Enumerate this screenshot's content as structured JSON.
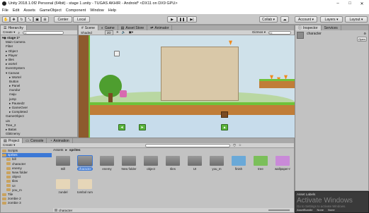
{
  "window": {
    "title": "Unity 2018.1.0f2 Personal (64bit) - stage 1.unity - TUGAS AKHIR - Android* <DX11 on DX9 GPU>",
    "minimize": "–",
    "maximize": "□",
    "close": "✕"
  },
  "menu": [
    "File",
    "Edit",
    "Assets",
    "GameObject",
    "Component",
    "Window",
    "Help"
  ],
  "toolbar": {
    "center": "Center",
    "local": "Local",
    "collab": "Collab ▾",
    "account": "Account ▾",
    "layers": "Layers ▾",
    "layout": "Layout ▾"
  },
  "hierarchy": {
    "tab": "Hierarchy",
    "create": "Create ▾",
    "search_placeholder": "All",
    "scene": "stage 1*",
    "items": [
      "Main Camera",
      "Fliter",
      "▸ Object",
      "▸ Player",
      "▸ tiles",
      "▸ wortel",
      "EventSystem",
      "▾ Canvas",
      "▸ Wortel",
      "Button",
      "▸ Panel",
      "mundur",
      "maju",
      "jump",
      "▸ Paused2",
      "▸ GameOver",
      "▸ Completed",
      "GameObject",
      "uis",
      "Tree_2",
      "▸ Batas",
      "GbEnemy"
    ]
  },
  "scene_view": {
    "tabs": [
      "Scene",
      "Game",
      "Asset Store",
      "Animator"
    ],
    "shaded": "Shaded",
    "mode_2d": "2D",
    "gizmos": "Gizmos ▾",
    "search_placeholder": "All"
  },
  "project": {
    "tabs": [
      "Project",
      "Console",
      "Animation"
    ],
    "create": "Create ▾",
    "tree": [
      "Scripts",
      "sprites",
      "bill",
      "character",
      "enemy",
      "New folder",
      "object",
      "tiles",
      "UI",
      "you_m",
      "Tile",
      "zombie 2",
      "zombie 3"
    ],
    "breadcrumb": [
      "Assets",
      "sprites"
    ],
    "assets_row1": [
      "Bill",
      "character",
      "enemy",
      "New folder",
      "object",
      "tiles",
      "UI",
      "you_m",
      "finish",
      "tree",
      "wallpaper-m"
    ],
    "assets_row2": [
      "zundel",
      "tombol ruml"
    ],
    "status_file": "character"
  },
  "inspector": {
    "tabs": [
      "Inspector",
      "Services"
    ],
    "name": "character",
    "open": "Open"
  },
  "asset_labels": {
    "title": "Asset Labels",
    "asset_bundle": "AssetBundle",
    "none1": "None",
    "none2": "None",
    "watermark1": "Activate Windows",
    "watermark2": "Go to Settings to activate Windows."
  },
  "colors": {
    "selection": "#3b78d6",
    "sky": "#cfe1ea",
    "grass": "#6fc23a",
    "dirt": "#c07d38"
  }
}
